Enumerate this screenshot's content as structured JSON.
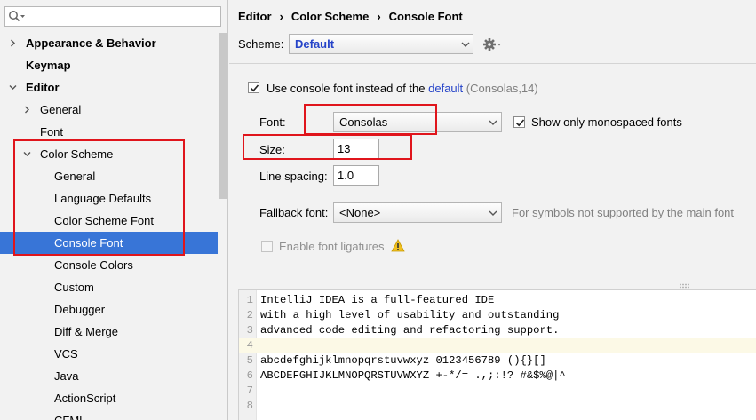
{
  "search": {
    "placeholder": ""
  },
  "sidebar": {
    "items": [
      {
        "label": "Appearance & Behavior",
        "bold": true,
        "arrow": "right"
      },
      {
        "label": "Keymap",
        "bold": true,
        "arrow": ""
      },
      {
        "label": "Editor",
        "bold": true,
        "arrow": "down"
      },
      {
        "label": "General",
        "bold": false,
        "arrow": "right"
      },
      {
        "label": "Font",
        "bold": false,
        "arrow": ""
      },
      {
        "label": "Color Scheme",
        "bold": false,
        "arrow": "down"
      },
      {
        "label": "General",
        "bold": false,
        "arrow": ""
      },
      {
        "label": "Language Defaults",
        "bold": false,
        "arrow": ""
      },
      {
        "label": "Color Scheme Font",
        "bold": false,
        "arrow": ""
      },
      {
        "label": "Console Font",
        "bold": false,
        "arrow": "",
        "selected": true
      },
      {
        "label": "Console Colors",
        "bold": false,
        "arrow": ""
      },
      {
        "label": "Custom",
        "bold": false,
        "arrow": ""
      },
      {
        "label": "Debugger",
        "bold": false,
        "arrow": ""
      },
      {
        "label": "Diff & Merge",
        "bold": false,
        "arrow": ""
      },
      {
        "label": "VCS",
        "bold": false,
        "arrow": ""
      },
      {
        "label": "Java",
        "bold": false,
        "arrow": ""
      },
      {
        "label": "ActionScript",
        "bold": false,
        "arrow": ""
      },
      {
        "label": "CFML",
        "bold": false,
        "arrow": ""
      }
    ]
  },
  "breadcrumb": [
    "Editor",
    "Color Scheme",
    "Console Font"
  ],
  "scheme": {
    "label": "Scheme:",
    "value": "Default"
  },
  "use_console_font": {
    "checked": true,
    "text_before": "Use console font instead of the ",
    "link": "default",
    "suffix": "(Consolas,14)"
  },
  "font": {
    "label": "Font:",
    "value": "Consolas"
  },
  "mono_only": {
    "checked": true,
    "label": "Show only monospaced fonts"
  },
  "size": {
    "label": "Size:",
    "value": "13"
  },
  "line_spacing": {
    "label": "Line spacing:",
    "value": "1.0"
  },
  "fallback": {
    "label": "Fallback font:",
    "value": "<None>",
    "hint": "For symbols not supported by the main font"
  },
  "ligatures": {
    "checked": false,
    "label": "Enable font ligatures"
  },
  "preview": {
    "lines": [
      {
        "n": "1",
        "text": "IntelliJ IDEA is a full-featured IDE"
      },
      {
        "n": "2",
        "text": "with a high level of usability and outstanding"
      },
      {
        "n": "3",
        "text": "advanced code editing and refactoring support."
      },
      {
        "n": "4",
        "text": "",
        "current": true
      },
      {
        "n": "5",
        "text": "abcdefghijklmnopqrstuvwxyz 0123456789 (){}[]"
      },
      {
        "n": "6",
        "text": "ABCDEFGHIJKLMNOPQRSTUVWXYZ +-*/= .,;:!? #&$%@|^"
      },
      {
        "n": "7",
        "text": ""
      },
      {
        "n": "8",
        "text": ""
      }
    ]
  },
  "colors": {
    "selection": "#3875d7",
    "link": "#2543c8",
    "annotation": "#e0151c",
    "current_line": "#fcf9e6"
  }
}
